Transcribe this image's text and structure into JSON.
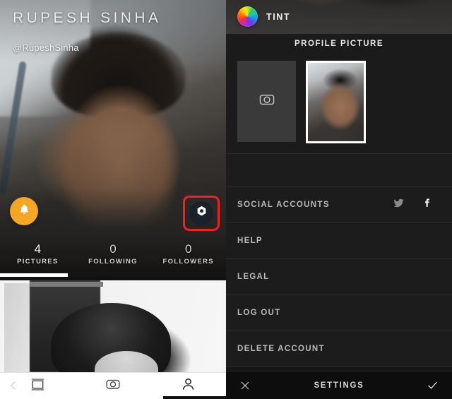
{
  "app": {
    "brand_name": "TINT",
    "brand_icon": "color-wheel-icon"
  },
  "left_panel": {
    "profile": {
      "display_name": "RUPESH SINHA",
      "handle": "@RupeshSinha",
      "notifications_icon": "bell-icon",
      "camera_icon": "aperture-camera-icon",
      "stats": [
        {
          "value": "4",
          "label": "PICTURES"
        },
        {
          "value": "0",
          "label": "FOLLOWING"
        },
        {
          "value": "0",
          "label": "FOLLOWERS"
        }
      ]
    },
    "bottom_nav": {
      "back_icon": "chevron-left-icon",
      "items": [
        {
          "icon": "feed-grid-icon",
          "name": "feed",
          "active": false
        },
        {
          "icon": "camera-icon",
          "name": "camera",
          "active": false
        },
        {
          "icon": "person-icon",
          "name": "profile",
          "active": true
        }
      ]
    }
  },
  "right_panel": {
    "section_title": "PROFILE PICTURE",
    "profile_picture": {
      "add_tile_icon": "camera-icon",
      "selected_thumbnail": "user-profile-photo"
    },
    "menu": [
      {
        "label": "SOCIAL ACCOUNTS",
        "icons": [
          "twitter-icon",
          "facebook-icon"
        ]
      },
      {
        "label": "HELP",
        "icons": []
      },
      {
        "label": "LEGAL",
        "icons": []
      },
      {
        "label": "LOG OUT",
        "icons": []
      },
      {
        "label": "DELETE ACCOUNT",
        "icons": []
      }
    ],
    "bottom_bar": {
      "cancel_icon": "close-x-icon",
      "title": "SETTINGS",
      "confirm_icon": "checkmark-icon"
    }
  },
  "colors": {
    "brand_accent": "#f5a623",
    "highlight_box": "#ee2222",
    "panel_bg": "#1c1c1c",
    "divider": "#2b2b2b",
    "menu_text": "#b9b9b9"
  }
}
